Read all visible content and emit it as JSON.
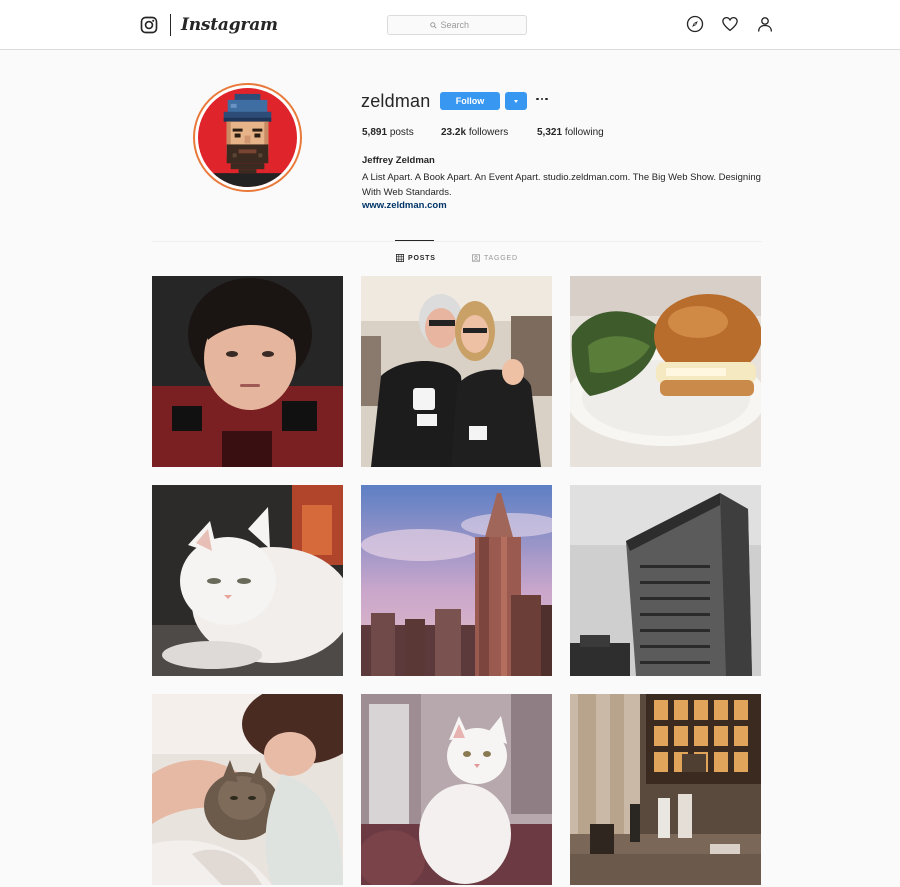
{
  "nav": {
    "wordmark": "Instagram",
    "search_placeholder": "Search",
    "icons": [
      "instagram-camera-icon",
      "compass-icon",
      "heart-icon",
      "person-icon"
    ]
  },
  "profile": {
    "username": "zeldman",
    "follow_label": "Follow",
    "stats": {
      "posts_value": "5,891",
      "posts_label": "posts",
      "followers_value": "23.2k",
      "followers_label": "followers",
      "following_value": "5,321",
      "following_label": "following"
    },
    "full_name": "Jeffrey Zeldman",
    "bio": "A List Apart. A Book Apart. An Event Apart. studio.zeldman.com. The Big Web Show. Designing With Web Standards.",
    "website": "www.zeldman.com"
  },
  "tabs": [
    {
      "label": "POSTS",
      "active": true
    },
    {
      "label": "TAGGED",
      "active": false
    }
  ],
  "colors": {
    "accent_blue": "#3897f0",
    "link_blue": "#003569",
    "avatar_ring": "#e8793a"
  },
  "posts": [
    {
      "subject": "selfie"
    },
    {
      "subject": "conference-photo"
    },
    {
      "subject": "sandwich"
    },
    {
      "subject": "white-cat"
    },
    {
      "subject": "skyscraper"
    },
    {
      "subject": "flatiron-building"
    },
    {
      "subject": "sleeping-with-cat"
    },
    {
      "subject": "white-cat-sitting"
    },
    {
      "subject": "station-interior"
    }
  ]
}
